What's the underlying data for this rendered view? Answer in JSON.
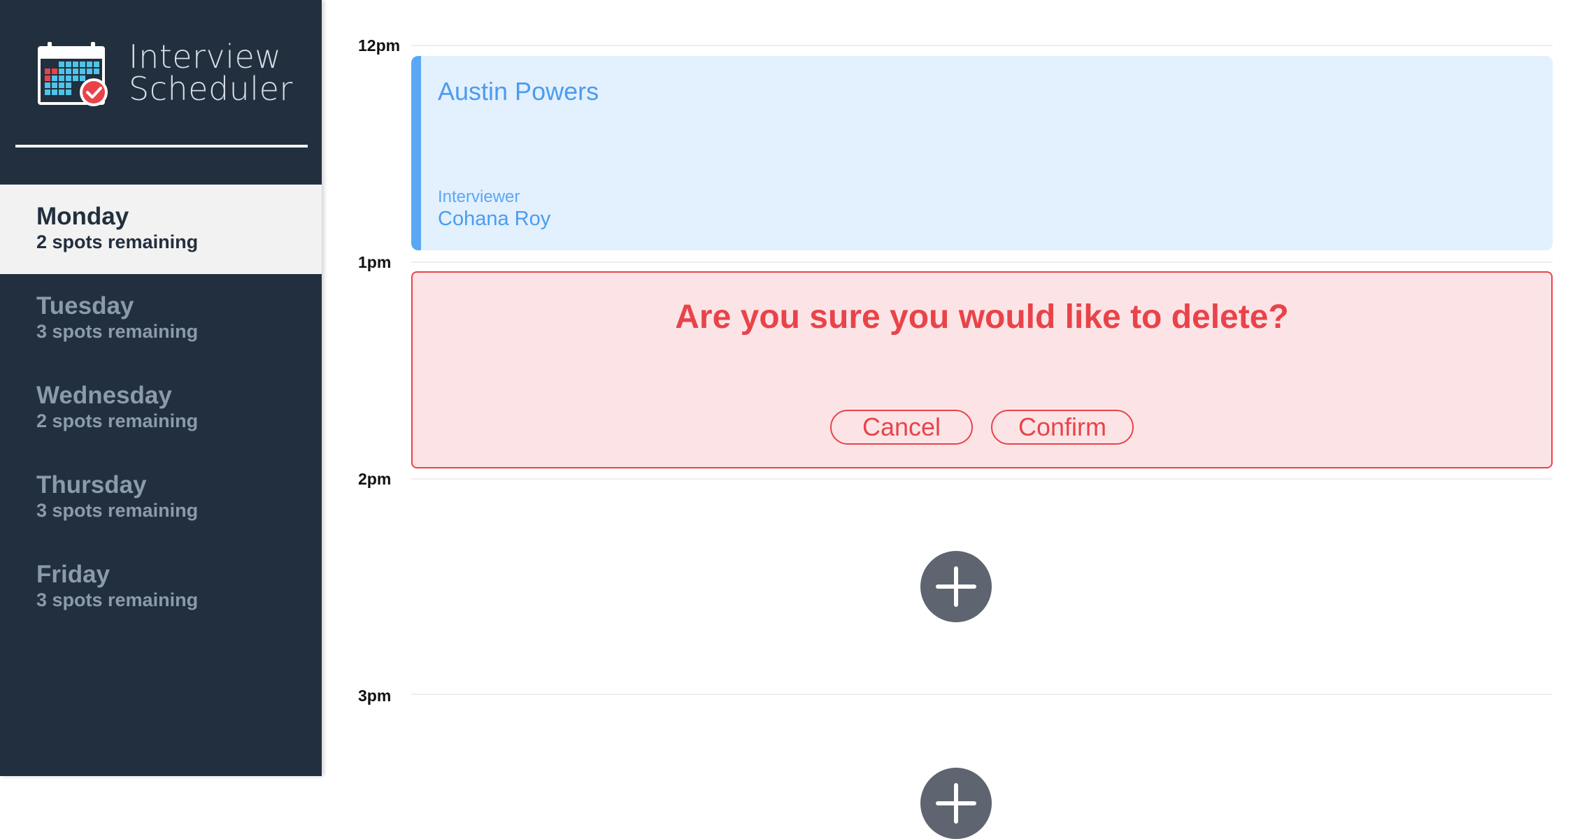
{
  "brand": {
    "line1": "Interview",
    "line2": "Scheduler",
    "logo_icon": "calendar-check-icon"
  },
  "days": [
    {
      "name": "Monday",
      "spots": "2 spots remaining",
      "selected": true
    },
    {
      "name": "Tuesday",
      "spots": "3 spots remaining",
      "selected": false
    },
    {
      "name": "Wednesday",
      "spots": "2 spots remaining",
      "selected": false
    },
    {
      "name": "Thursday",
      "spots": "3 spots remaining",
      "selected": false
    },
    {
      "name": "Friday",
      "spots": "3 spots remaining",
      "selected": false
    }
  ],
  "hours": [
    "12pm",
    "1pm",
    "2pm",
    "3pm"
  ],
  "appointment": {
    "student": "Austin Powers",
    "interviewer_label": "Interviewer",
    "interviewer": "Cohana Roy"
  },
  "confirm": {
    "message": "Are you sure you would like to delete?",
    "cancel_label": "Cancel",
    "confirm_label": "Confirm"
  },
  "add_icon": "plus-icon",
  "colors": {
    "sidebar_bg": "#222f3e",
    "selected_bg": "#f2f2f2",
    "appointment_bg": "#e3f0fd",
    "appointment_accent": "#5aa8f5",
    "danger": "#e9434a",
    "danger_bg": "#fce4e6",
    "add_button": "#5e6570"
  }
}
